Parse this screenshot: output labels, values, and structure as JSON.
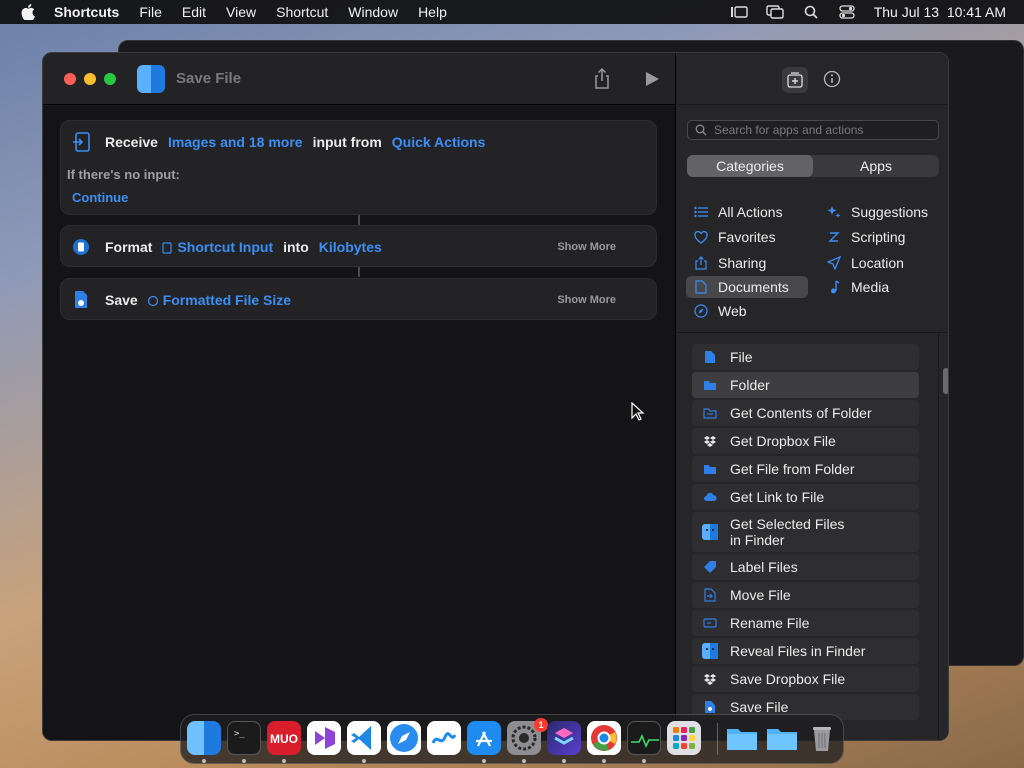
{
  "menubar": {
    "app": "Shortcuts",
    "items": [
      "File",
      "Edit",
      "View",
      "Shortcut",
      "Window",
      "Help"
    ],
    "datetime": "Thu Jul 13  10:41 AM"
  },
  "window": {
    "title": "Save File"
  },
  "actions": {
    "receive": {
      "label": "Receive",
      "input_types": "Images and 18 more",
      "connector": "input from",
      "source": "Quick Actions",
      "no_input_label": "If there's no input:",
      "no_input_value": "Continue"
    },
    "format": {
      "label": "Format",
      "variable": "Shortcut Input",
      "connector": "into",
      "unit": "Kilobytes",
      "show_more": "Show More"
    },
    "save": {
      "label": "Save",
      "variable": "Formatted File Size",
      "show_more": "Show More"
    }
  },
  "panel": {
    "search_placeholder": "Search for apps and actions",
    "segments": [
      "Categories",
      "Apps"
    ],
    "categories_left": [
      "All Actions",
      "Favorites",
      "Sharing",
      "Documents",
      "Web"
    ],
    "categories_right": [
      "Suggestions",
      "Scripting",
      "Location",
      "Media"
    ],
    "selected_category": "Documents",
    "list": [
      "File",
      "Folder",
      "Get Contents of Folder",
      "Get Dropbox File",
      "Get File from Folder",
      "Get Link to File",
      "Get Selected Files in Finder",
      "Label Files",
      "Move File",
      "Rename File",
      "Reveal Files in Finder",
      "Save Dropbox File",
      "Save File"
    ],
    "highlighted_item": "Folder"
  },
  "dock": {
    "apps": [
      "Finder",
      "Terminal",
      "MUO",
      "Visual Studio",
      "VS Code",
      "Safari",
      "Freeform",
      "App Store",
      "System Settings",
      "Shortcuts",
      "Chrome",
      "Activity Monitor",
      "Launchpad",
      "Folder",
      "Folder",
      "Trash"
    ],
    "badge": "1"
  },
  "colors": {
    "accent": "#3a8ef5",
    "window_bg": "#1c1c1e",
    "panel_bg": "#262628"
  }
}
